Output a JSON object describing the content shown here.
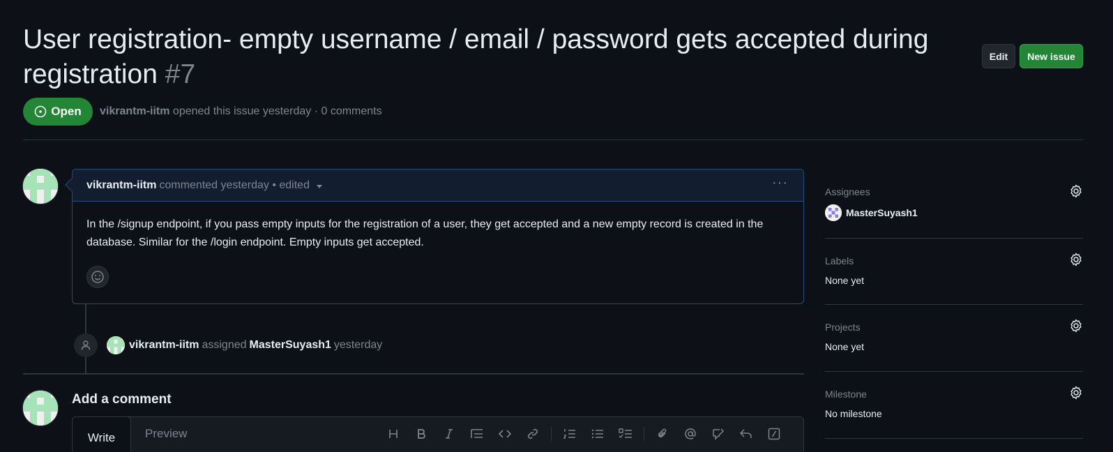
{
  "issue": {
    "title": "User registration- empty username / email / password gets accepted during registration",
    "number": "#7",
    "state": "Open",
    "author": "vikrantm-iitm",
    "opened_text": "opened this issue yesterday · 0 comments"
  },
  "header_buttons": {
    "edit": "Edit",
    "new_issue": "New issue"
  },
  "comment": {
    "author": "vikrantm-iitm",
    "meta": "commented yesterday • edited",
    "more": "···",
    "body": "In the /signup endpoint, if you pass empty inputs for the registration of a user, they get accepted and a new empty record is created in the database. Similar for the /login endpoint. Empty inputs get accepted."
  },
  "event": {
    "actor": "vikrantm-iitm",
    "action": "assigned",
    "target": "MasterSuyash1",
    "time": "yesterday"
  },
  "add_comment": {
    "title": "Add a comment",
    "tabs": {
      "write": "Write",
      "preview": "Preview"
    },
    "toolbar": [
      "heading-icon",
      "bold-icon",
      "italic-icon",
      "quote-icon",
      "code-icon",
      "link-icon",
      "ordered-list-icon",
      "unordered-list-icon",
      "task-list-icon",
      "attach-icon",
      "mention-icon",
      "reference-icon",
      "reply-icon",
      "slash-command-icon"
    ]
  },
  "sidebar": {
    "assignees": {
      "title": "Assignees",
      "user": "MasterSuyash1"
    },
    "labels": {
      "title": "Labels",
      "value": "None yet"
    },
    "projects": {
      "title": "Projects",
      "value": "None yet"
    },
    "milestone": {
      "title": "Milestone",
      "value": "No milestone"
    }
  },
  "colors": {
    "background": "#0d1117",
    "open_green": "#238636",
    "comment_border": "#1f4d82",
    "muted_text": "#7d8590"
  }
}
